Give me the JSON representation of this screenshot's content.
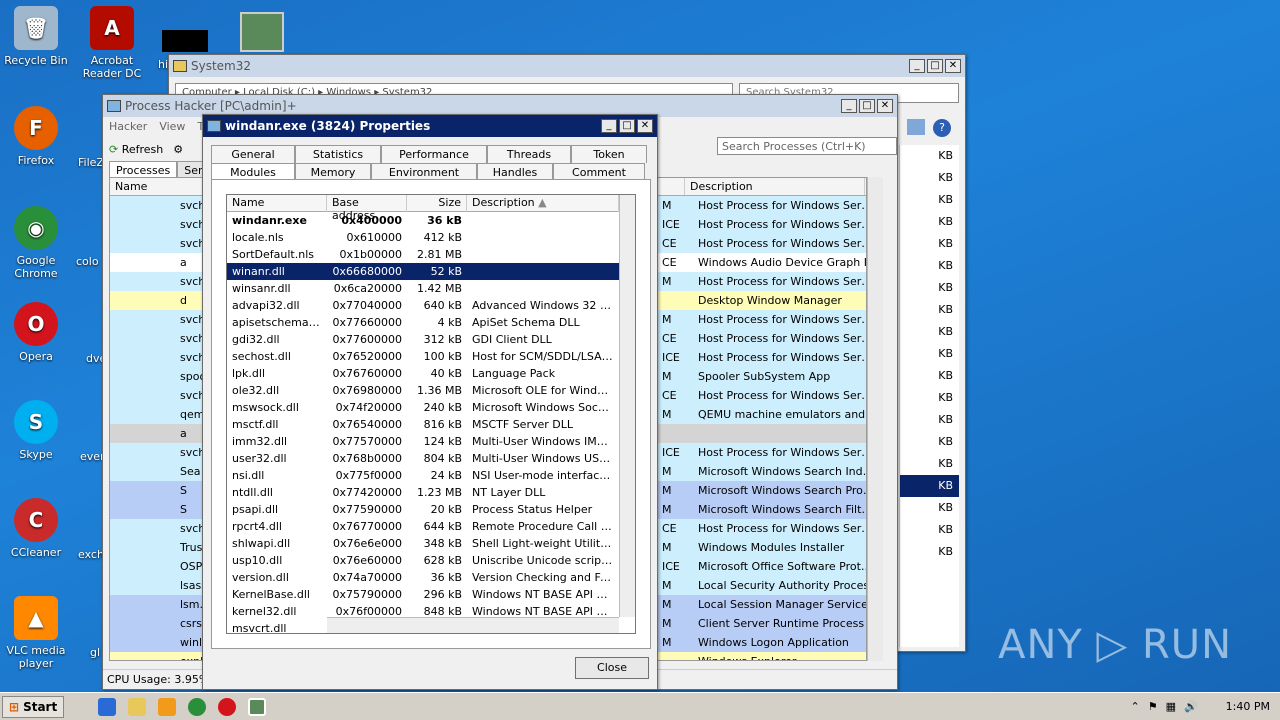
{
  "desktop": {
    "icons": [
      {
        "label": "Recycle Bin",
        "icon": "recycle-bin-icon"
      },
      {
        "label": "Acrobat Reader DC",
        "icon": "acrobat-icon"
      },
      {
        "label": "Firefox",
        "icon": "firefox-icon"
      },
      {
        "label": "FileZ",
        "icon": "filezilla-icon"
      },
      {
        "label": "Google Chrome",
        "icon": "chrome-icon"
      },
      {
        "label": "colo",
        "icon": "file-icon"
      },
      {
        "label": "Opera",
        "icon": "opera-icon"
      },
      {
        "label": "dve",
        "icon": "file-icon"
      },
      {
        "label": "Skype",
        "icon": "skype-icon"
      },
      {
        "label": "ever",
        "icon": "file-icon"
      },
      {
        "label": "CCleaner",
        "icon": "ccleaner-icon"
      },
      {
        "label": "exch",
        "icon": "file-icon"
      },
      {
        "label": "VLC media player",
        "icon": "vlc-icon"
      },
      {
        "label": "gl",
        "icon": "file-icon"
      },
      {
        "label": "hi",
        "icon": "file-icon"
      }
    ]
  },
  "explorer": {
    "title": "System32",
    "path": "Computer ▸ Local Disk (C:) ▸ Windows ▸ System32",
    "search_placeholder": "Search System32",
    "sizes": [
      "KB",
      "KB",
      "KB",
      "KB",
      "KB",
      "KB",
      "KB",
      "KB",
      "KB",
      "KB",
      "KB",
      "KB",
      "KB",
      "KB",
      "KB",
      "KB",
      "KB",
      "KB",
      "KB",
      "KB"
    ]
  },
  "process_hacker": {
    "title": "Process Hacker [PC\\admin]+",
    "menu": [
      "Hacker",
      "View",
      "To"
    ],
    "refresh_label": "Refresh",
    "tabs": [
      "Processes",
      "Servic"
    ],
    "search_placeholder": "Search Processes (Ctrl+K)",
    "columns": {
      "name": "Name",
      "description": "Description"
    },
    "rows": [
      {
        "name": "svch",
        "u": "M",
        "desc": "Host Process for Windows Services",
        "bg": "cyan"
      },
      {
        "name": "svch",
        "u": "ICE",
        "desc": "Host Process for Windows Services",
        "bg": "cyan"
      },
      {
        "name": "svch",
        "u": "CE",
        "desc": "Host Process for Windows Services",
        "bg": "cyan"
      },
      {
        "name": "a",
        "u": "CE",
        "desc": "Windows Audio Device Graph Is...",
        "bg": "white"
      },
      {
        "name": "svch",
        "u": "M",
        "desc": "Host Process for Windows Services",
        "bg": "cyan"
      },
      {
        "name": "d",
        "u": "",
        "desc": "Desktop Window Manager",
        "bg": "yellow"
      },
      {
        "name": "svch",
        "u": "M",
        "desc": "Host Process for Windows Services",
        "bg": "cyan"
      },
      {
        "name": "svch",
        "u": "CE",
        "desc": "Host Process for Windows Services",
        "bg": "cyan"
      },
      {
        "name": "svch",
        "u": "ICE",
        "desc": "Host Process for Windows Services",
        "bg": "cyan"
      },
      {
        "name": "spoo",
        "u": "M",
        "desc": "Spooler SubSystem App",
        "bg": "cyan"
      },
      {
        "name": "svch",
        "u": "CE",
        "desc": "Host Process for Windows Services",
        "bg": "cyan"
      },
      {
        "name": "qem",
        "u": "M",
        "desc": "QEMU machine emulators and tools",
        "bg": "cyan"
      },
      {
        "name": "a",
        "u": "",
        "desc": "",
        "bg": "gray"
      },
      {
        "name": "svch",
        "u": "ICE",
        "desc": "Host Process for Windows Services",
        "bg": "cyan"
      },
      {
        "name": "Sea",
        "u": "M",
        "desc": "Microsoft Windows Search Indexer",
        "bg": "cyan"
      },
      {
        "name": "S",
        "u": "M",
        "desc": "Microsoft Windows Search Proto...",
        "bg": "blue"
      },
      {
        "name": "S",
        "u": "M",
        "desc": "Microsoft Windows Search Filter ...",
        "bg": "blue"
      },
      {
        "name": "svch",
        "u": "CE",
        "desc": "Host Process for Windows Services",
        "bg": "cyan"
      },
      {
        "name": "Trus",
        "u": "M",
        "desc": "Windows Modules Installer",
        "bg": "cyan"
      },
      {
        "name": "OSP",
        "u": "ICE",
        "desc": "Microsoft Office Software Prote...",
        "bg": "cyan"
      },
      {
        "name": "lsass.e",
        "u": "M",
        "desc": "Local Security Authority Process",
        "bg": "cyan"
      },
      {
        "name": "lsm.exe",
        "u": "M",
        "desc": "Local Session Manager Service",
        "bg": "blue"
      },
      {
        "name": "csrss.exe",
        "u": "M",
        "desc": "Client Server Runtime Process",
        "bg": "blue"
      },
      {
        "name": "winlogon.e",
        "u": "M",
        "desc": "Windows Logon Application",
        "bg": "blue"
      },
      {
        "name": "explorer.e",
        "u": "",
        "desc": "Windows Explorer",
        "bg": "yellow"
      }
    ],
    "status": "CPU Usage: 3.95%"
  },
  "properties": {
    "title": "windanr.exe (3824) Properties",
    "tabs_row1": [
      "General",
      "Statistics",
      "Performance",
      "Threads",
      "Token"
    ],
    "tabs_row2": [
      "Modules",
      "Memory",
      "Environment",
      "Handles",
      "Comment"
    ],
    "columns": {
      "name": "Name",
      "base": "Base address",
      "size": "Size",
      "desc": "Description"
    },
    "modules": [
      {
        "name": "windanr.exe",
        "base": "0x400000",
        "size": "36 kB",
        "desc": ""
      },
      {
        "name": "locale.nls",
        "base": "0x610000",
        "size": "412 kB",
        "desc": ""
      },
      {
        "name": "SortDefault.nls",
        "base": "0x1b00000",
        "size": "2.81 MB",
        "desc": ""
      },
      {
        "name": "winanr.dll",
        "base": "0x66680000",
        "size": "52 kB",
        "desc": ""
      },
      {
        "name": "winsanr.dll",
        "base": "0x6ca20000",
        "size": "1.42 MB",
        "desc": ""
      },
      {
        "name": "advapi32.dll",
        "base": "0x77040000",
        "size": "640 kB",
        "desc": "Advanced Windows 32 Base..."
      },
      {
        "name": "apisetschema.dll",
        "base": "0x77660000",
        "size": "4 kB",
        "desc": "ApiSet Schema DLL"
      },
      {
        "name": "gdi32.dll",
        "base": "0x77600000",
        "size": "312 kB",
        "desc": "GDI Client DLL"
      },
      {
        "name": "sechost.dll",
        "base": "0x76520000",
        "size": "100 kB",
        "desc": "Host for SCM/SDDL/LSA Loo..."
      },
      {
        "name": "lpk.dll",
        "base": "0x76760000",
        "size": "40 kB",
        "desc": "Language Pack"
      },
      {
        "name": "ole32.dll",
        "base": "0x76980000",
        "size": "1.36 MB",
        "desc": "Microsoft OLE for Windows"
      },
      {
        "name": "mswsock.dll",
        "base": "0x74f20000",
        "size": "240 kB",
        "desc": "Microsoft Windows Sockets ..."
      },
      {
        "name": "msctf.dll",
        "base": "0x76540000",
        "size": "816 kB",
        "desc": "MSCTF Server DLL"
      },
      {
        "name": "imm32.dll",
        "base": "0x77570000",
        "size": "124 kB",
        "desc": "Multi-User Windows IMM32 ..."
      },
      {
        "name": "user32.dll",
        "base": "0x768b0000",
        "size": "804 kB",
        "desc": "Multi-User Windows USER A..."
      },
      {
        "name": "nsi.dll",
        "base": "0x775f0000",
        "size": "24 kB",
        "desc": "NSI User-mode interface DLL"
      },
      {
        "name": "ntdll.dll",
        "base": "0x77420000",
        "size": "1.23 MB",
        "desc": "NT Layer DLL"
      },
      {
        "name": "psapi.dll",
        "base": "0x77590000",
        "size": "20 kB",
        "desc": "Process Status Helper"
      },
      {
        "name": "rpcrt4.dll",
        "base": "0x76770000",
        "size": "644 kB",
        "desc": "Remote Procedure Call Runt..."
      },
      {
        "name": "shlwapi.dll",
        "base": "0x76e6e000",
        "size": "348 kB",
        "desc": "Shell Light-weight Utility Libr..."
      },
      {
        "name": "usp10.dll",
        "base": "0x76e60000",
        "size": "628 kB",
        "desc": "Uniscribe Unicode script pro..."
      },
      {
        "name": "version.dll",
        "base": "0x74a70000",
        "size": "36 kB",
        "desc": "Version Checking and File In..."
      },
      {
        "name": "KernelBase.dll",
        "base": "0x75790000",
        "size": "296 kB",
        "desc": "Windows NT BASE API Clien..."
      },
      {
        "name": "kernel32.dll",
        "base": "0x76f00000",
        "size": "848 kB",
        "desc": "Windows NT BASE API Clien..."
      },
      {
        "name": "msvcrt.dll",
        "base": "",
        "size": "",
        "desc": ""
      }
    ],
    "close_label": "Close"
  },
  "taskbar": {
    "start_label": "Start",
    "clock": "1:40 PM"
  },
  "watermark": "ANY ▷ RUN"
}
